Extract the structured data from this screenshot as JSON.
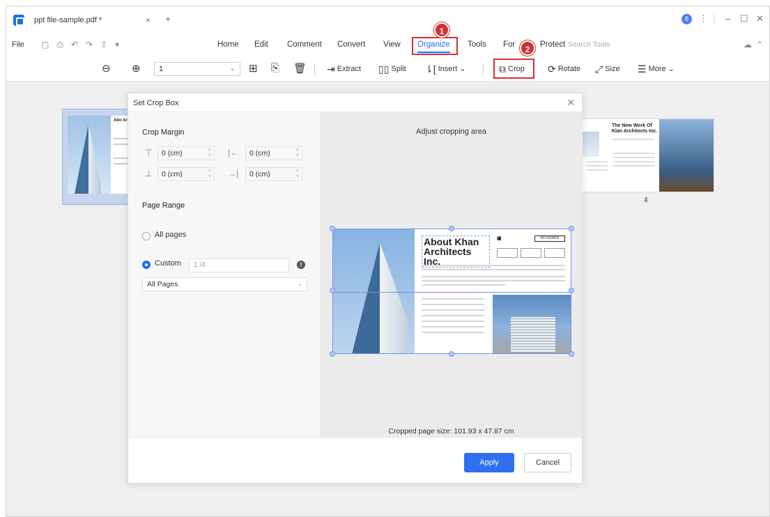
{
  "titlebar": {
    "doc_tab": "ppt file-sample.pdf *",
    "close_glyph": "×",
    "new_tab_glyph": "+",
    "avatar_initial": "8",
    "window_controls": [
      "⋮",
      "|",
      "–",
      "☐",
      "✕"
    ]
  },
  "menubar": {
    "file": "File",
    "quick_icons": "▢⎙↶↷⇧▾",
    "items": [
      "Home",
      "Edit",
      "Comment",
      "Convert",
      "View",
      "Organize",
      "Tools",
      "For",
      "Protect"
    ],
    "active": "Organize",
    "search_tools": "Search Tools"
  },
  "callouts": [
    "1",
    "2"
  ],
  "toolbar": {
    "zoom_out_icon": "zoom-out-icon",
    "zoom_in_icon": "zoom-in-icon",
    "page_value": "1",
    "extract": "Extract",
    "split": "Split",
    "insert": "Insert",
    "crop": "Crop",
    "rotate": "Rotate",
    "size": "Size",
    "more": "More"
  },
  "thumbnails": {
    "left_title": "Abo Arc",
    "right_title": "The New Work Of Klan Architects Inc.",
    "right_page_number": "4"
  },
  "dialog": {
    "title": "Set Crop Box",
    "crop_margin_label": "Crop Margin",
    "margins": {
      "top": "0 (cm)",
      "left": "0 (cm)",
      "bottom": "0 (cm)",
      "right": "0 (cm)"
    },
    "page_range_label": "Page Range",
    "all_pages_label": "All pages",
    "custom_label": "Custom",
    "custom_value": "1 /4",
    "info_glyph": "!",
    "range_select": "All Pages",
    "adjust_label": "Adjust cropping area",
    "preview_title": "About Khan Architects Inc.",
    "preview_reviewer": "REVIEWER",
    "cropped_size": "Cropped page size: 101.93 x 47.87 cm",
    "apply": "Apply",
    "cancel": "Cancel"
  },
  "colors": {
    "accent": "#1d6ef5",
    "highlight": "#d32f2f",
    "apply_button": "#2f6ff0"
  }
}
